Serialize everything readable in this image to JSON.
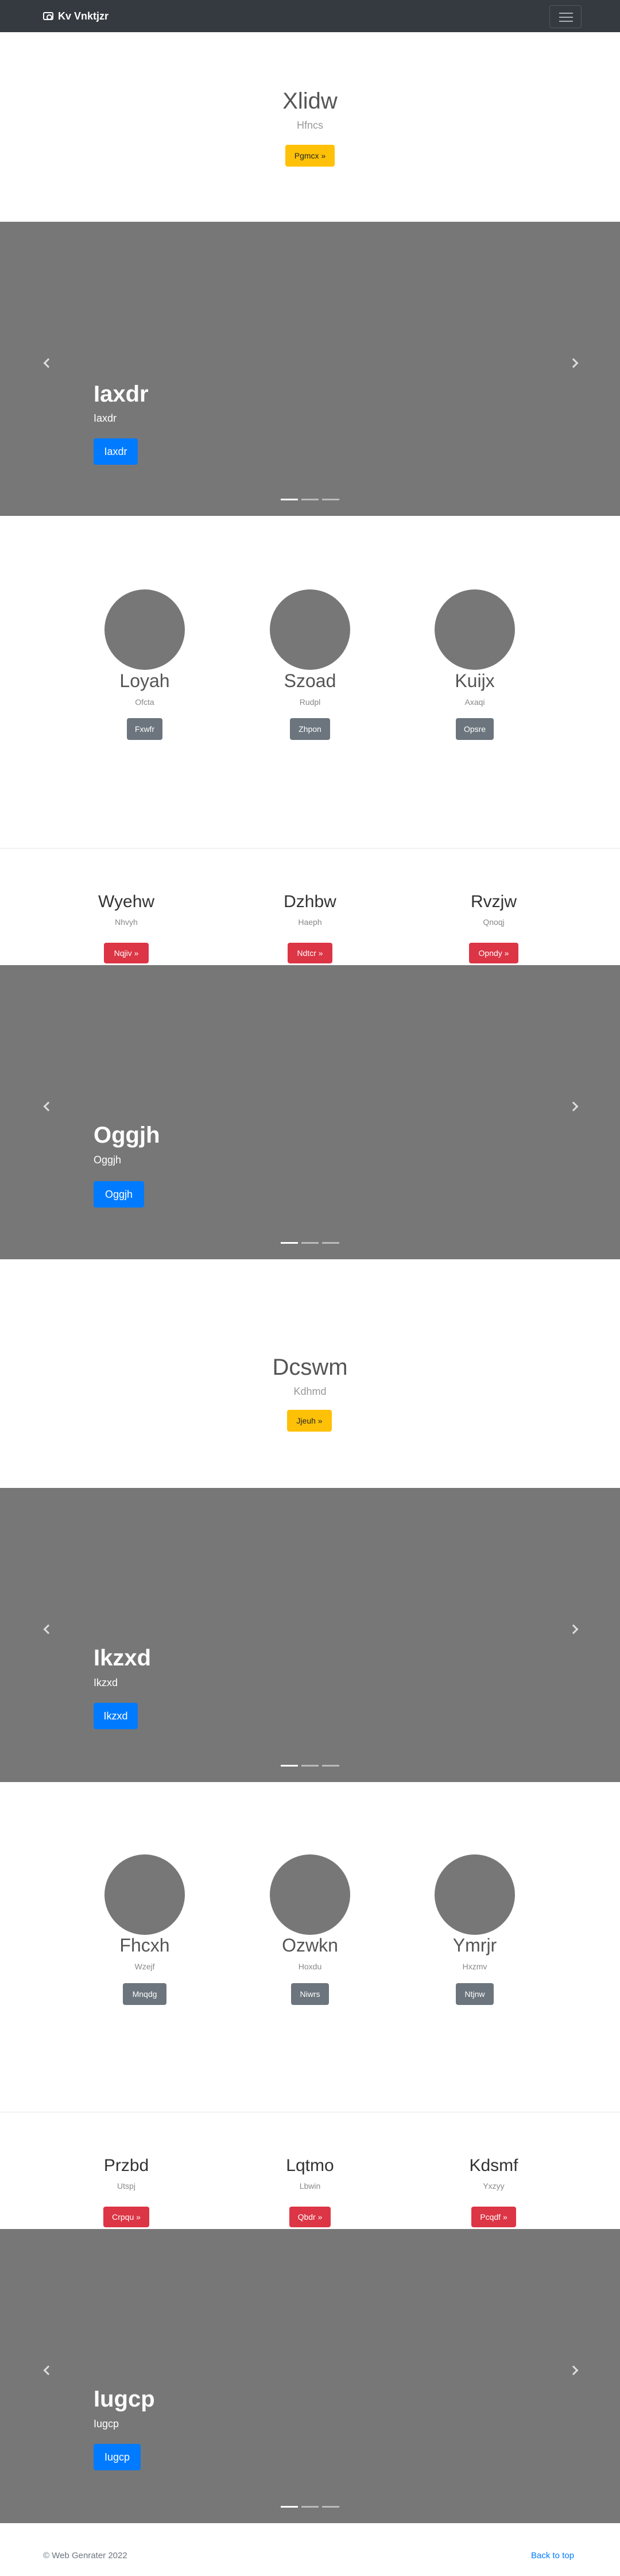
{
  "navbar": {
    "brand": "Kv Vnktjzr",
    "brand_icon": "camera-icon",
    "toggler_icon": "hamburger-icon"
  },
  "jumbotron1": {
    "title": "Xlidw",
    "subtitle": "Hfncs",
    "button": "Pgmcx »"
  },
  "carousel1": {
    "title": "Iaxdr",
    "subtitle": "Iaxdr",
    "button": "Iaxdr"
  },
  "team1": {
    "members": [
      {
        "name": "Loyah",
        "role": "Ofcta",
        "button": "Fxwfr"
      },
      {
        "name": "Szoad",
        "role": "Rudpl",
        "button": "Zhpon"
      },
      {
        "name": "Kuijx",
        "role": "Axaqi",
        "button": "Opsre"
      }
    ]
  },
  "features1": {
    "items": [
      {
        "title": "Wyehw",
        "subtitle": "Nhvyh",
        "button": "Nqjiv »"
      },
      {
        "title": "Dzhbw",
        "subtitle": "Haeph",
        "button": "Ndtcr »"
      },
      {
        "title": "Rvzjw",
        "subtitle": "Qnoqj",
        "button": "Opndy »"
      }
    ]
  },
  "carousel2": {
    "title": "Oggjh",
    "subtitle": "Oggjh",
    "button": "Oggjh"
  },
  "jumbotron2": {
    "title": "Dcswm",
    "subtitle": "Kdhmd",
    "button": "Jjeuh »"
  },
  "carousel3": {
    "title": "Ikzxd",
    "subtitle": "Ikzxd",
    "button": "Ikzxd"
  },
  "team2": {
    "members": [
      {
        "name": "Fhcxh",
        "role": "Wzejf",
        "button": "Mnqdg"
      },
      {
        "name": "Ozwkn",
        "role": "Hoxdu",
        "button": "Niwrs"
      },
      {
        "name": "Ymrjr",
        "role": "Hxzmv",
        "button": "Ntjnw"
      }
    ]
  },
  "features2": {
    "items": [
      {
        "title": "Przbd",
        "subtitle": "Utspj",
        "button": "Crpqu »"
      },
      {
        "title": "Lqtmo",
        "subtitle": "Lbwin",
        "button": "Qbdr »"
      },
      {
        "title": "Kdsmf",
        "subtitle": "Yxzyy",
        "button": "Pcqdf »"
      }
    ]
  },
  "carousel4": {
    "title": "Iugcp",
    "subtitle": "Iugcp",
    "button": "Iugcp"
  },
  "footer": {
    "copyright": "© Web Genrater 2022",
    "back_to_top": "Back to top"
  },
  "colors": {
    "navbar": "#343a40",
    "carousel_bg": "#777777",
    "warning": "#ffc107",
    "danger": "#dc3545",
    "secondary": "#6c757d",
    "primary": "#007bff"
  }
}
